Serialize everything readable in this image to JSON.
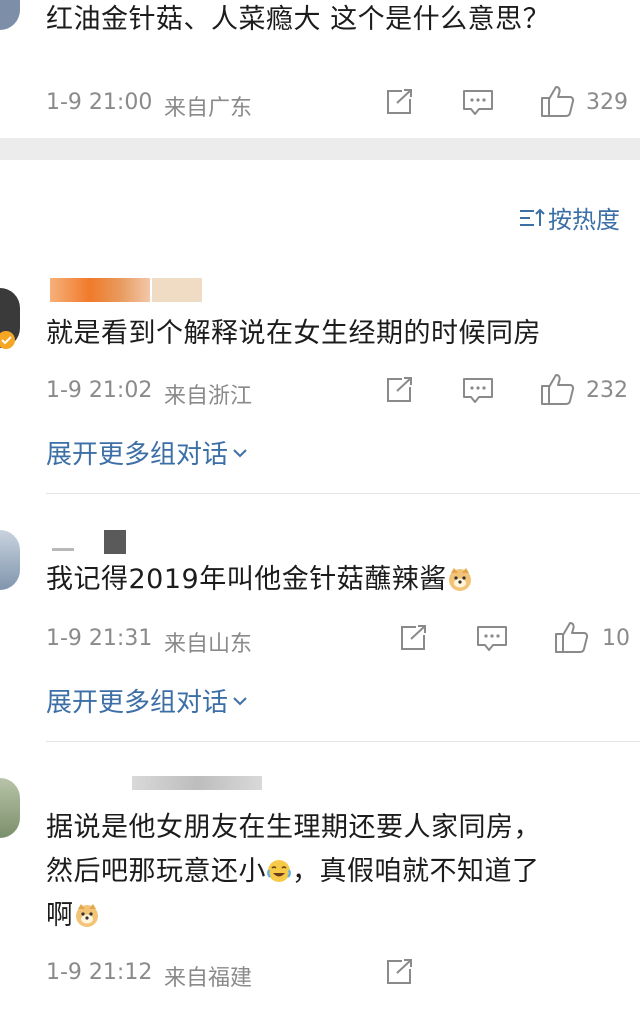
{
  "top_comment": {
    "text": "红油金针菇、人菜瘾大 这个是什么意思？",
    "time": "1-9 21:00",
    "location": "来自广东",
    "likes": "329"
  },
  "sort": {
    "label": "按热度",
    "icon": "sort-icon"
  },
  "comments": [
    {
      "text": "就是看到个解释说在女生经期的时候同房",
      "time": "1-9 21:02",
      "location": "来自浙江",
      "likes": "232",
      "expand_label": "展开更多组对话"
    },
    {
      "text": "我记得2019年叫他金针菇蘸辣酱",
      "time": "1-9 21:31",
      "location": "来自山东",
      "likes": "10",
      "expand_label": "展开更多组对话"
    },
    {
      "text_line1": "据说是他女朋友在生理期还要人家同房，",
      "text_line2a": "然后吧那玩意还小",
      "text_line2b": "，真假咱就不知道了",
      "text_line3": "啊",
      "time": "1-9 21:12",
      "location": "来自福建"
    }
  ],
  "icons": {
    "repost": "repost-icon",
    "comment": "comment-icon",
    "like": "like-icon",
    "verified": "verified-badge-icon",
    "doge": "doge-emoji-icon",
    "laugh_cry": "laugh-cry-emoji-icon"
  },
  "colors": {
    "link": "#3b6fa6",
    "meta": "#8a8a8a",
    "separator": "#ececec",
    "verified": "#f5a623"
  }
}
